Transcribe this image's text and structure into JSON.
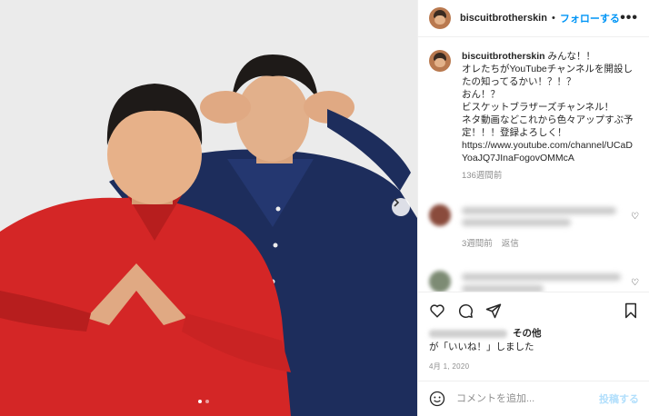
{
  "header": {
    "username": "biscuitbrotherskin",
    "separator": "•",
    "follow_label": "フォローする",
    "more_label": "•••"
  },
  "caption": {
    "username": "biscuitbrotherskin",
    "text": "みんな！！\nオレたちがYouTubeチャンネルを開設したの知ってるかい！？！？\nおん！？\nビスケットブラザーズチャンネル！\nネタ動画などこれから色々アップすぶ予定！！！登録よろしく！\nhttps://www.youtube.com/channel/UCaDYoaJQ7JInaFogovOMMcA",
    "age": "136週間前"
  },
  "comments": [
    {
      "age": "3週間前",
      "reply_label": "返信"
    },
    {
      "age": "",
      "reply_label": ""
    }
  ],
  "likes": {
    "suffix_bold": "その他",
    "suffix_text": "が「いいね！」しました"
  },
  "date": "4月 1, 2020",
  "add_comment": {
    "placeholder": "コメントを追加...",
    "post_label": "投稿する"
  },
  "icons": {
    "like": "heart-icon",
    "comment": "comment-icon",
    "share": "share-icon",
    "save": "bookmark-icon",
    "emoji": "emoji-icon",
    "next": "chevron-right-icon"
  },
  "colors": {
    "accent": "#0095f6",
    "post_disabled": "#b2dffc",
    "meta": "#8e8e8e",
    "red_shirt": "#d42626",
    "navy_shirt": "#1d2d5c"
  }
}
